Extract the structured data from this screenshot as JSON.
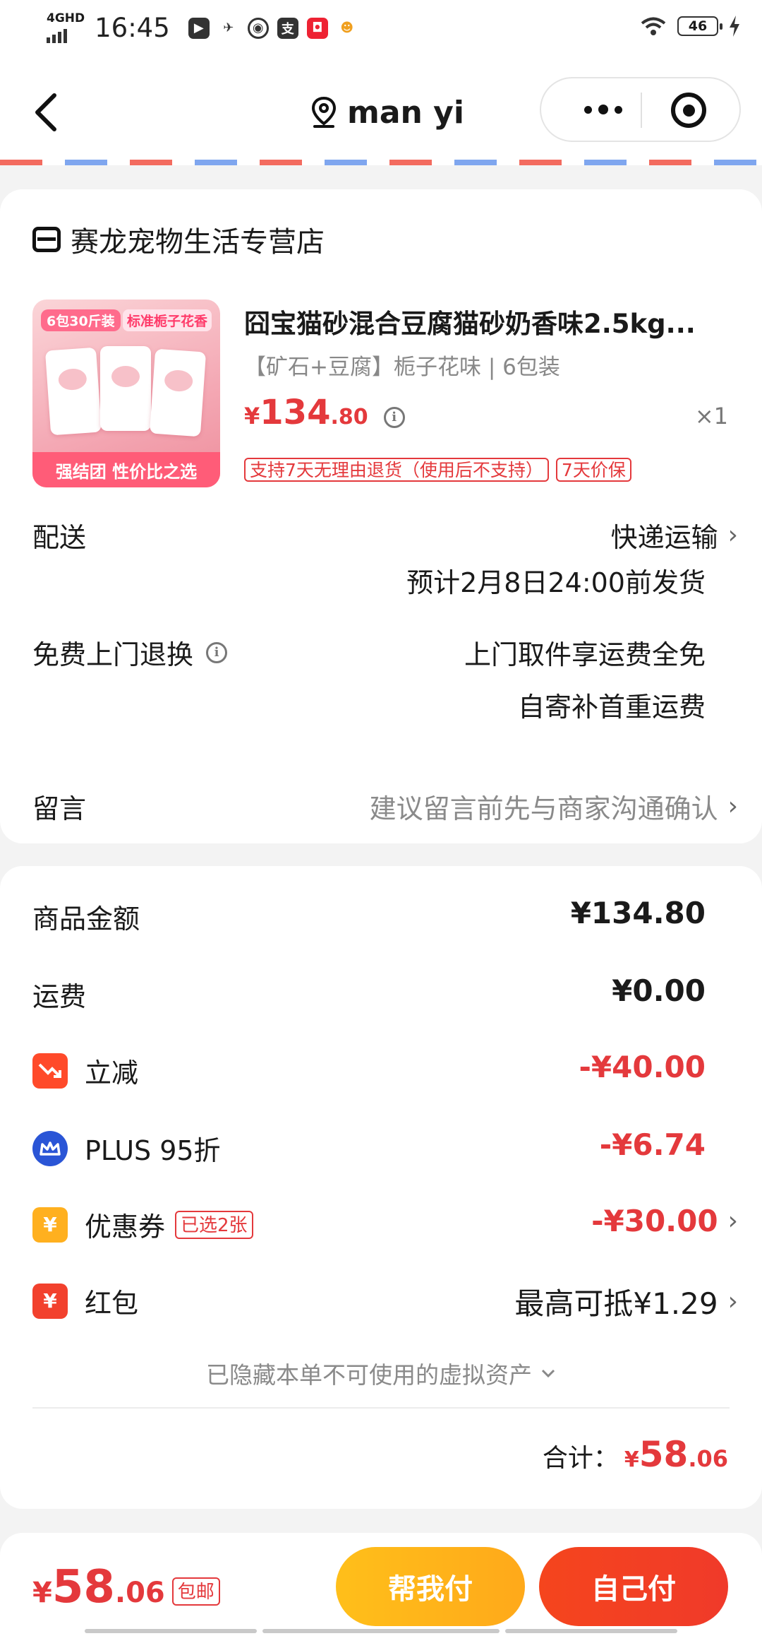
{
  "status_bar": {
    "network": "4GHD",
    "time": "16:45",
    "battery": "46"
  },
  "nav": {
    "title": "man yi"
  },
  "store": {
    "name": "赛龙宠物生活专营店"
  },
  "product": {
    "image_tag_left": "6包30斤装",
    "image_tag_right": "标准栀子花香",
    "image_slogan": "强结团 性价比之选",
    "title": "囧宝猫砂混合豆腐猫砂奶香味2.5kg...",
    "spec": "【矿石+豆腐】栀子花味 | 6包装",
    "price_symbol": "¥",
    "price_int": "134",
    "price_dec": ".80",
    "qty": "×1",
    "badges": [
      "支持7天无理由退货（使用后不支持）",
      "7天价保"
    ]
  },
  "delivery": {
    "label": "配送",
    "method": "快递运输",
    "eta": "预计2月8日24:00前发货"
  },
  "return_service": {
    "label": "免费上门退换",
    "line1": "上门取件享运费全免",
    "line2": "自寄补首重运费"
  },
  "message": {
    "label": "留言",
    "placeholder": "建议留言前先与商家沟通确认"
  },
  "summary": {
    "goods_label": "商品金额",
    "goods_value": "¥134.80",
    "shipping_label": "运费",
    "shipping_value": "¥0.00",
    "discount_label": "立减",
    "discount_value": "-¥40.00",
    "plus_label": "PLUS 95折",
    "plus_value": "-¥6.74",
    "coupon_label": "优惠券",
    "coupon_badge": "已选2张",
    "coupon_value": "-¥30.00",
    "redpacket_label": "红包",
    "redpacket_value": "最高可抵¥1.29",
    "hidden_assets": "已隐藏本单不可使用的虚拟资产",
    "total_label": "合计：",
    "total_symbol": "¥",
    "total_int": "58",
    "total_dec": ".06"
  },
  "bottom_bar": {
    "price_symbol": "¥",
    "price_int": "58",
    "price_dec": ".06",
    "free_shipping": "包邮",
    "help_pay": "帮我付",
    "self_pay": "自己付"
  },
  "colors": {
    "accent_red": "#e4393c",
    "help_pay_bg": "#ffbb1a",
    "self_pay_bg": "#f3411f"
  }
}
